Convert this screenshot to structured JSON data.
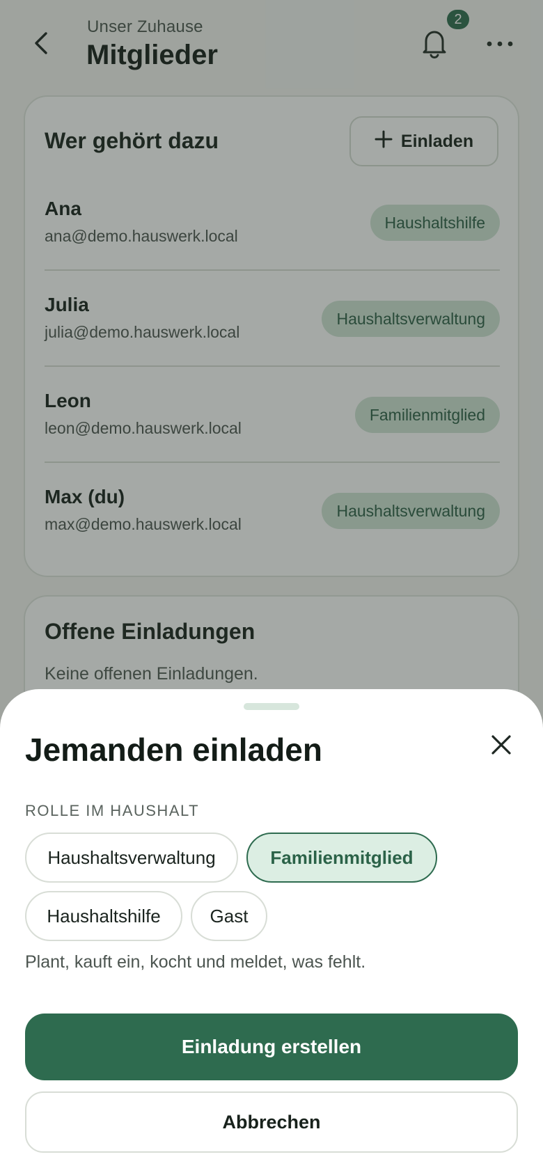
{
  "header": {
    "subtitle": "Unser Zuhause",
    "title": "Mitglieder",
    "notification_count": "2",
    "icons": {
      "back": "chevron-left-icon",
      "notifications": "bell-icon",
      "more": "more-horizontal-icon"
    }
  },
  "members_card": {
    "title": "Wer gehört dazu",
    "invite_button": "Einladen",
    "members": [
      {
        "name": "Ana",
        "email": "ana@demo.hauswerk.local",
        "role": "Haushaltshilfe"
      },
      {
        "name": "Julia",
        "email": "julia@demo.hauswerk.local",
        "role": "Haushaltsverwaltung"
      },
      {
        "name": "Leon",
        "email": "leon@demo.hauswerk.local",
        "role": "Familienmitglied"
      },
      {
        "name": "Max (du)",
        "email": "max@demo.hauswerk.local",
        "role": "Haushaltsverwaltung"
      }
    ]
  },
  "invites_card": {
    "title": "Offene Einladungen",
    "empty_text": "Keine offenen Einladungen."
  },
  "sheet": {
    "title": "Jemanden einladen",
    "section_label": "ROLLE IM HAUSHALT",
    "roles": [
      "Haushaltsverwaltung",
      "Familienmitglied",
      "Haushaltshilfe",
      "Gast"
    ],
    "selected_role": "Familienmitglied",
    "role_description": "Plant, kauft ein, kocht und meldet, was fehlt.",
    "primary_button": "Einladung erstellen",
    "secondary_button": "Abbrechen"
  },
  "colors": {
    "accent": "#2e6b4f",
    "role_pill_bg": "#cfe3d5",
    "selected_chip_bg": "#dceee3"
  }
}
